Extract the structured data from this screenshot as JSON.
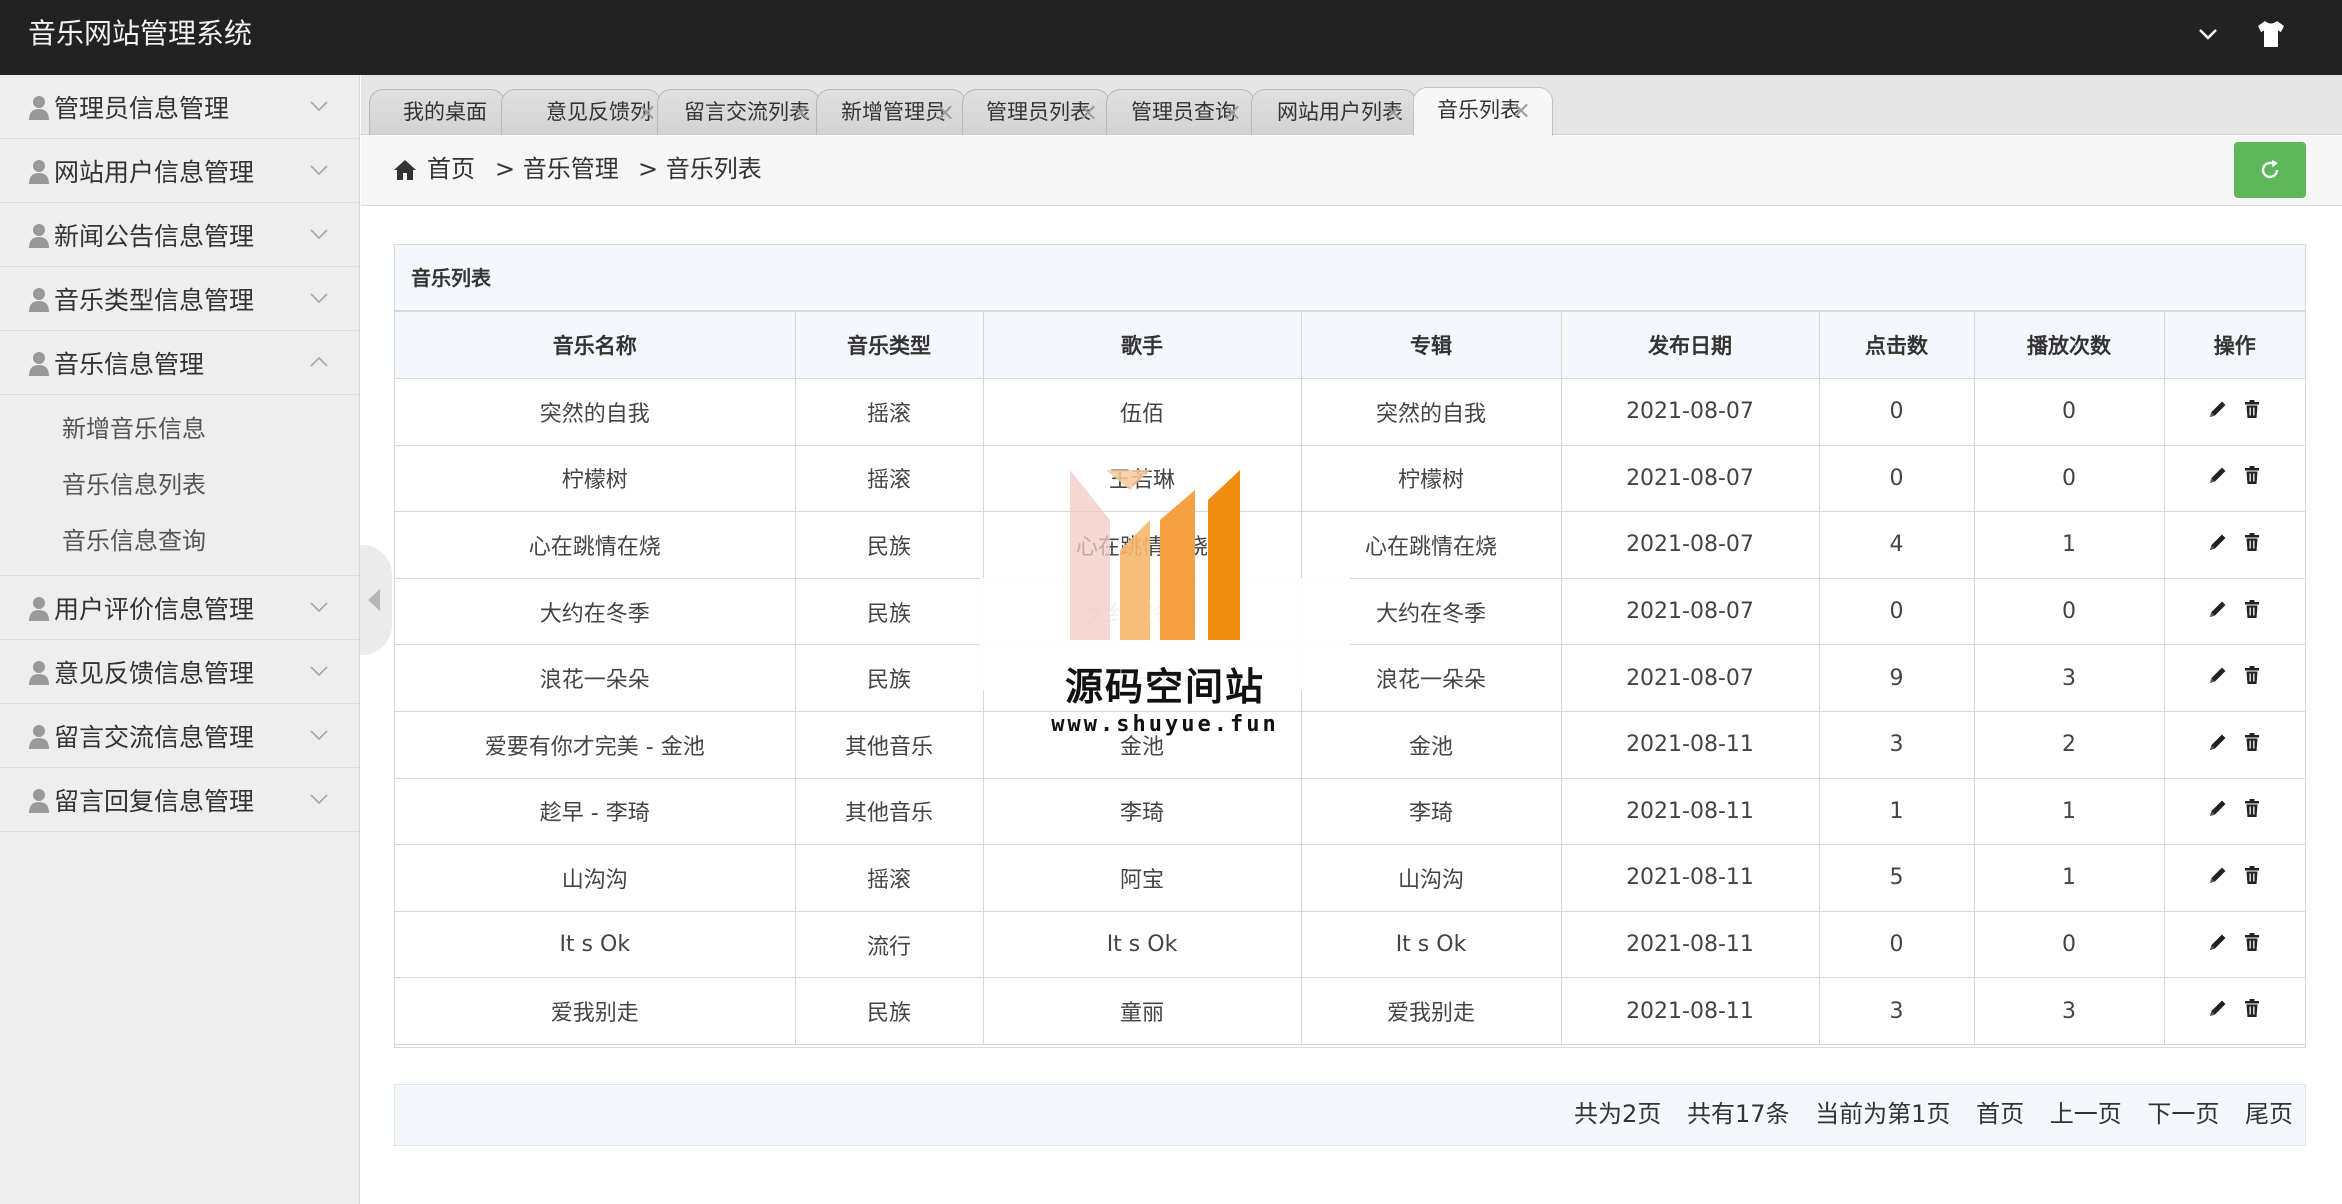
{
  "app": {
    "title": "音乐网站管理系统"
  },
  "header": {
    "icons": [
      "chevron-down-icon",
      "tshirt-icon"
    ]
  },
  "sidebar": {
    "items": [
      {
        "label": "管理员信息管理",
        "expanded": false
      },
      {
        "label": "网站用户信息管理",
        "expanded": false
      },
      {
        "label": "新闻公告信息管理",
        "expanded": false
      },
      {
        "label": "音乐类型信息管理",
        "expanded": false
      },
      {
        "label": "音乐信息管理",
        "expanded": true
      },
      {
        "label": "用户评价信息管理",
        "expanded": false
      },
      {
        "label": "意见反馈信息管理",
        "expanded": false
      },
      {
        "label": "留言交流信息管理",
        "expanded": false
      },
      {
        "label": "留言回复信息管理",
        "expanded": false
      }
    ],
    "subitems": [
      "新增音乐信息",
      "音乐信息列表",
      "音乐信息查询"
    ]
  },
  "tabs": [
    {
      "label": "我的桌面",
      "closable": false
    },
    {
      "label": "意见反馈列表",
      "closable": true
    },
    {
      "label": "留言交流列表",
      "closable": true
    },
    {
      "label": "新增管理员",
      "closable": true
    },
    {
      "label": "管理员列表",
      "closable": true
    },
    {
      "label": "管理员查询",
      "closable": true
    },
    {
      "label": "网站用户列表",
      "closable": true
    },
    {
      "label": "音乐列表",
      "closable": true,
      "active": true
    }
  ],
  "tab_close_glyph": "×",
  "breadcrumb": {
    "home": "首页",
    "level1": "> 音乐管理",
    "level2": ">  音乐列表"
  },
  "panel": {
    "title": "音乐列表",
    "columns": [
      "音乐名称",
      "音乐类型",
      "歌手",
      "专辑",
      "发布日期",
      "点击数",
      "播放次数",
      "操作"
    ],
    "rows": [
      [
        "突然的自我",
        "摇滚",
        "伍佰",
        "突然的自我",
        "2021-08-07",
        "0",
        "0"
      ],
      [
        "柠檬树",
        "摇滚",
        "王若琳",
        "柠檬树",
        "2021-08-07",
        "0",
        "0"
      ],
      [
        "心在跳情在烧",
        "民族",
        "心在跳情在烧",
        "心在跳情在烧",
        "2021-08-07",
        "4",
        "1"
      ],
      [
        "大约在冬季",
        "民族",
        "大约在冬季",
        "大约在冬季",
        "2021-08-07",
        "0",
        "0"
      ],
      [
        "浪花一朵朵",
        "民族",
        "浪花一朵朵",
        "浪花一朵朵",
        "2021-08-07",
        "9",
        "3"
      ],
      [
        "爱要有你才完美 - 金池",
        "其他音乐",
        "金池",
        "金池",
        "2021-08-11",
        "3",
        "2"
      ],
      [
        "趁早 - 李琦",
        "其他音乐",
        "李琦",
        "李琦",
        "2021-08-11",
        "1",
        "1"
      ],
      [
        "山沟沟",
        "摇滚",
        "阿宝",
        "山沟沟",
        "2021-08-11",
        "5",
        "1"
      ],
      [
        "It s Ok",
        "流行",
        "It s Ok",
        "It s Ok",
        "2021-08-11",
        "0",
        "0"
      ],
      [
        "爱我别走",
        "民族",
        "童丽",
        "爱我别走",
        "2021-08-11",
        "3",
        "3"
      ]
    ],
    "row_actions": [
      "edit-icon",
      "delete-icon"
    ]
  },
  "pagination": {
    "total_pages": "共为2页",
    "total_records": "共有17条",
    "current": "当前为第1页",
    "first": "首页",
    "prev": "上一页",
    "next": "下一页",
    "last": "尾页"
  },
  "watermark": {
    "title": "源码空间站",
    "url": "www.shuyue.fun"
  },
  "colors": {
    "header_bg": "#222222",
    "sidebar_bg": "#eeeeee",
    "refresh_button": "#5fb75b",
    "table_header_bg": "#f4f7fc",
    "watermark_orange": "#f39a2b"
  }
}
